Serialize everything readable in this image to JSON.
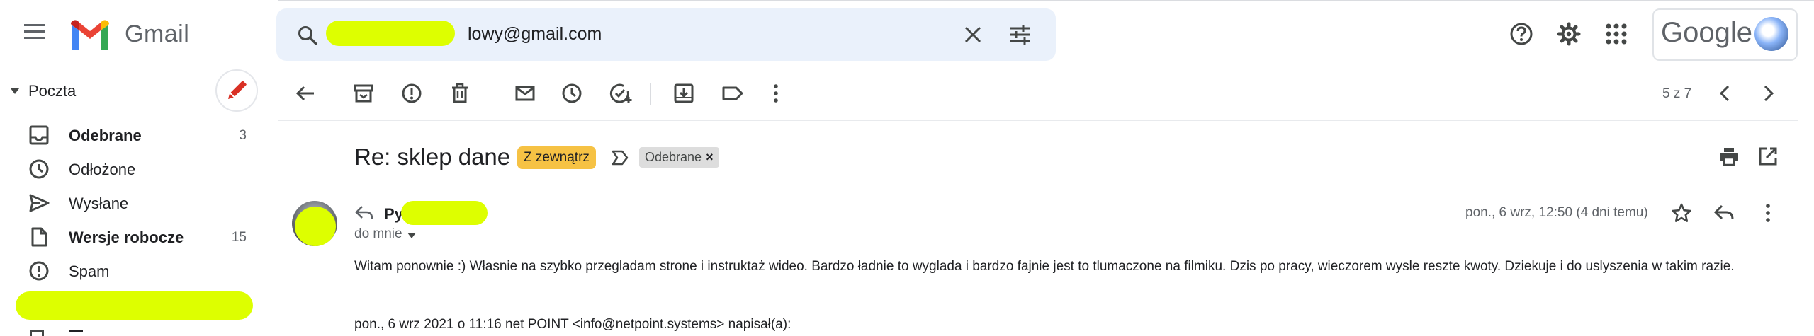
{
  "header": {
    "app_name": "Gmail",
    "search_value": "lowy@gmail.com",
    "account_brand": "Google"
  },
  "sidebar": {
    "section_label": "Poczta",
    "items": [
      {
        "label": "Odebrane",
        "count": "3",
        "icon": "inbox-icon",
        "bold": true
      },
      {
        "label": "Odłożone",
        "count": "",
        "icon": "clock-icon",
        "bold": false
      },
      {
        "label": "Wysłane",
        "count": "",
        "icon": "send-icon",
        "bold": false
      },
      {
        "label": "Wersje robocze",
        "count": "15",
        "icon": "draft-icon",
        "bold": true
      },
      {
        "label": "Spam",
        "count": "",
        "icon": "spam-icon",
        "bold": false
      }
    ]
  },
  "toolbar": {
    "pager": "5 z 7"
  },
  "message": {
    "subject": "Re: sklep dane",
    "labels": {
      "external": "Z zewnątrz",
      "inbox": "Odebrane",
      "inbox_remove": "×"
    },
    "sender_name": "Py",
    "recipient": "do mnie",
    "date": "pon., 6 wrz, 12:50 (4 dni temu)",
    "body": "Witam ponownie :) Własnie na szybko przegladam strone i instruktaż wideo. Bardzo ładnie to wyglada i bardzo fajnie jest to tlumaczone na filmiku. Dzis po pracy, wieczorem wysle reszte kwoty. Dziekuje i do uslyszenia w takim razie.",
    "quote_header": "pon., 6 wrz 2021 o 11:16 net POINT <info@netpoint.systems> napisał(a):"
  },
  "colors": {
    "search_bg": "#eaf1fb",
    "label_external": "#f6c244",
    "label_inbox": "#dddddd",
    "redaction": "#ddff00"
  }
}
